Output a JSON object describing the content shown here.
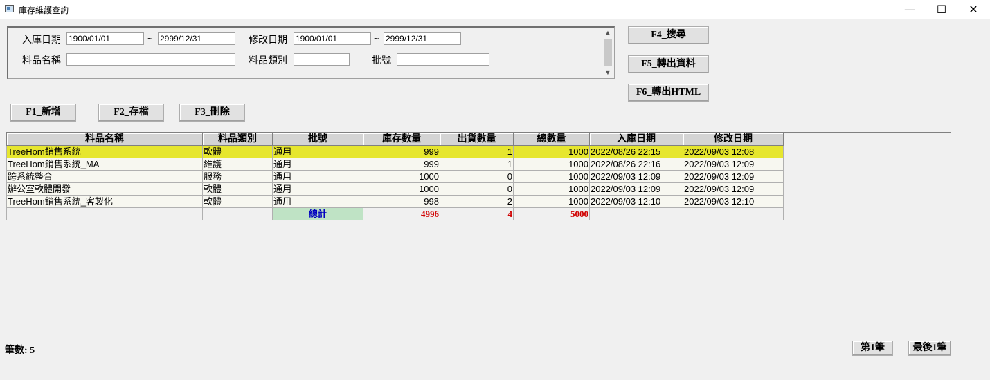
{
  "window": {
    "title": "庫存維護查詢",
    "minimize": "—",
    "maximize": "☐",
    "close": "✕"
  },
  "search": {
    "in_date_label": "入庫日期",
    "in_date_from": "1900/01/01",
    "in_date_to": "2999/12/31",
    "mod_date_label": "修改日期",
    "mod_date_from": "1900/01/01",
    "mod_date_to": "2999/12/31",
    "tilde": "~",
    "item_name_label": "料品名稱",
    "item_name_value": "",
    "item_category_label": "料品類別",
    "item_category_value": "",
    "batch_label": "批號",
    "batch_value": ""
  },
  "buttons": {
    "search": "F4_搜尋",
    "export_data": "F5_轉出資料",
    "export_html": "F6_轉出HTML",
    "add": "F1_新增",
    "save": "F2_存檔",
    "delete": "F3_刪除",
    "first": "第1筆",
    "last": "最後1筆"
  },
  "table": {
    "headers": [
      "料品名稱",
      "料品類別",
      "批號",
      "庫存數量",
      "出貨數量",
      "總數量",
      "入庫日期",
      "修改日期"
    ],
    "rows": [
      [
        "TreeHom銷售系統",
        "軟體",
        "通用",
        "999",
        "1",
        "1000",
        "2022/08/26  22:15",
        "2022/09/03  12:08"
      ],
      [
        "TreeHom銷售系統_MA",
        "維護",
        "通用",
        "999",
        "1",
        "1000",
        "2022/08/26  22:16",
        "2022/09/03  12:09"
      ],
      [
        "跨系統整合",
        "服務",
        "通用",
        "1000",
        "0",
        "1000",
        "2022/09/03  12:09",
        "2022/09/03  12:09"
      ],
      [
        "辦公室軟體開發",
        "軟體",
        "通用",
        "1000",
        "0",
        "1000",
        "2022/09/03  12:09",
        "2022/09/03  12:09"
      ],
      [
        "TreeHom銷售系統_客製化",
        "軟體",
        "通用",
        "998",
        "2",
        "1000",
        "2022/09/03  12:10",
        "2022/09/03  12:10"
      ]
    ],
    "total_label": "總計",
    "total_stock": "4996",
    "total_shipped": "4",
    "total_qty": "5000"
  },
  "status": {
    "count_label": "筆數: 5"
  },
  "colors": {
    "selected_row": "#e6e62e",
    "total_label_bg": "#bfe3c5",
    "total_label_text": "#0000c0",
    "total_num_text": "#d00000"
  }
}
